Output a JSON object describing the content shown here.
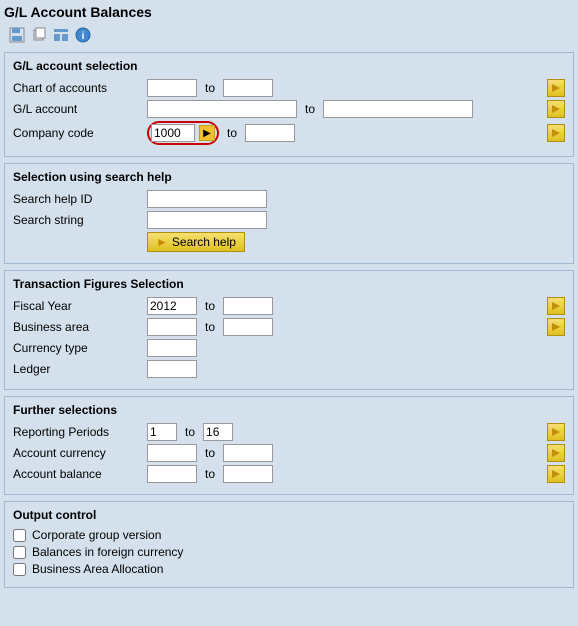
{
  "title": "G/L Account Balances",
  "toolbar": {
    "icons": [
      "save-icon",
      "copy-icon",
      "layout-icon",
      "info-icon"
    ]
  },
  "sections": {
    "gl_account_selection": {
      "title": "G/L account selection",
      "fields": [
        {
          "label": "Chart of accounts",
          "value": "",
          "to_value": ""
        },
        {
          "label": "G/L account",
          "value": "",
          "to_value": ""
        },
        {
          "label": "Company code",
          "value": "1000",
          "to_value": ""
        }
      ]
    },
    "search_help": {
      "title": "Selection using search help",
      "fields": [
        {
          "label": "Search help ID",
          "value": ""
        },
        {
          "label": "Search string",
          "value": ""
        }
      ],
      "button_label": "Search help"
    },
    "transaction_figures": {
      "title": "Transaction Figures Selection",
      "fields": [
        {
          "label": "Fiscal Year",
          "value": "2012",
          "to_value": ""
        },
        {
          "label": "Business area",
          "value": "",
          "to_value": ""
        },
        {
          "label": "Currency type",
          "value": ""
        },
        {
          "label": "Ledger",
          "value": ""
        }
      ]
    },
    "further_selections": {
      "title": "Further selections",
      "fields": [
        {
          "label": "Reporting Periods",
          "value": "1",
          "to_value": "16"
        },
        {
          "label": "Account currency",
          "value": "",
          "to_value": ""
        },
        {
          "label": "Account balance",
          "value": "",
          "to_value": ""
        }
      ]
    },
    "output_control": {
      "title": "Output control",
      "checkboxes": [
        {
          "label": "Corporate group version",
          "checked": false
        },
        {
          "label": "Balances in foreign currency",
          "checked": false
        },
        {
          "label": "Business Area Allocation",
          "checked": false
        }
      ]
    }
  }
}
